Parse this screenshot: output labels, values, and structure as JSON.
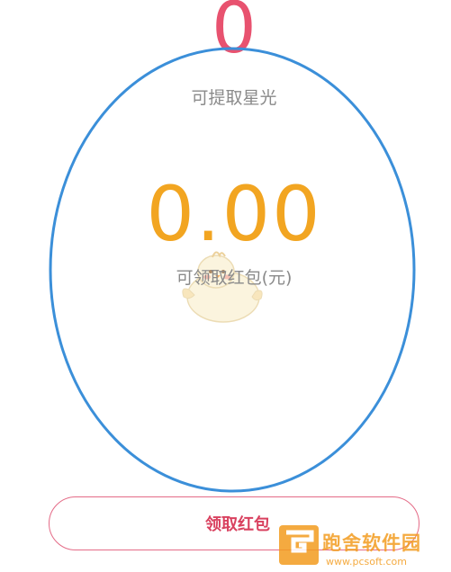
{
  "stars": {
    "value": "0",
    "label": "可提取星光"
  },
  "red_packet": {
    "amount": "0.00",
    "label": "可领取红包(元)"
  },
  "claim_button": {
    "label": "领取红包"
  },
  "watermark": {
    "site_name": "跑舍软件园",
    "url": "www.pcsoft.com"
  },
  "colors": {
    "stars_value": "#e8526f",
    "amount": "#f2a521",
    "button_border": "#e46b87",
    "button_text": "#d9415f",
    "annotation_ellipse": "#3b8fd9"
  }
}
